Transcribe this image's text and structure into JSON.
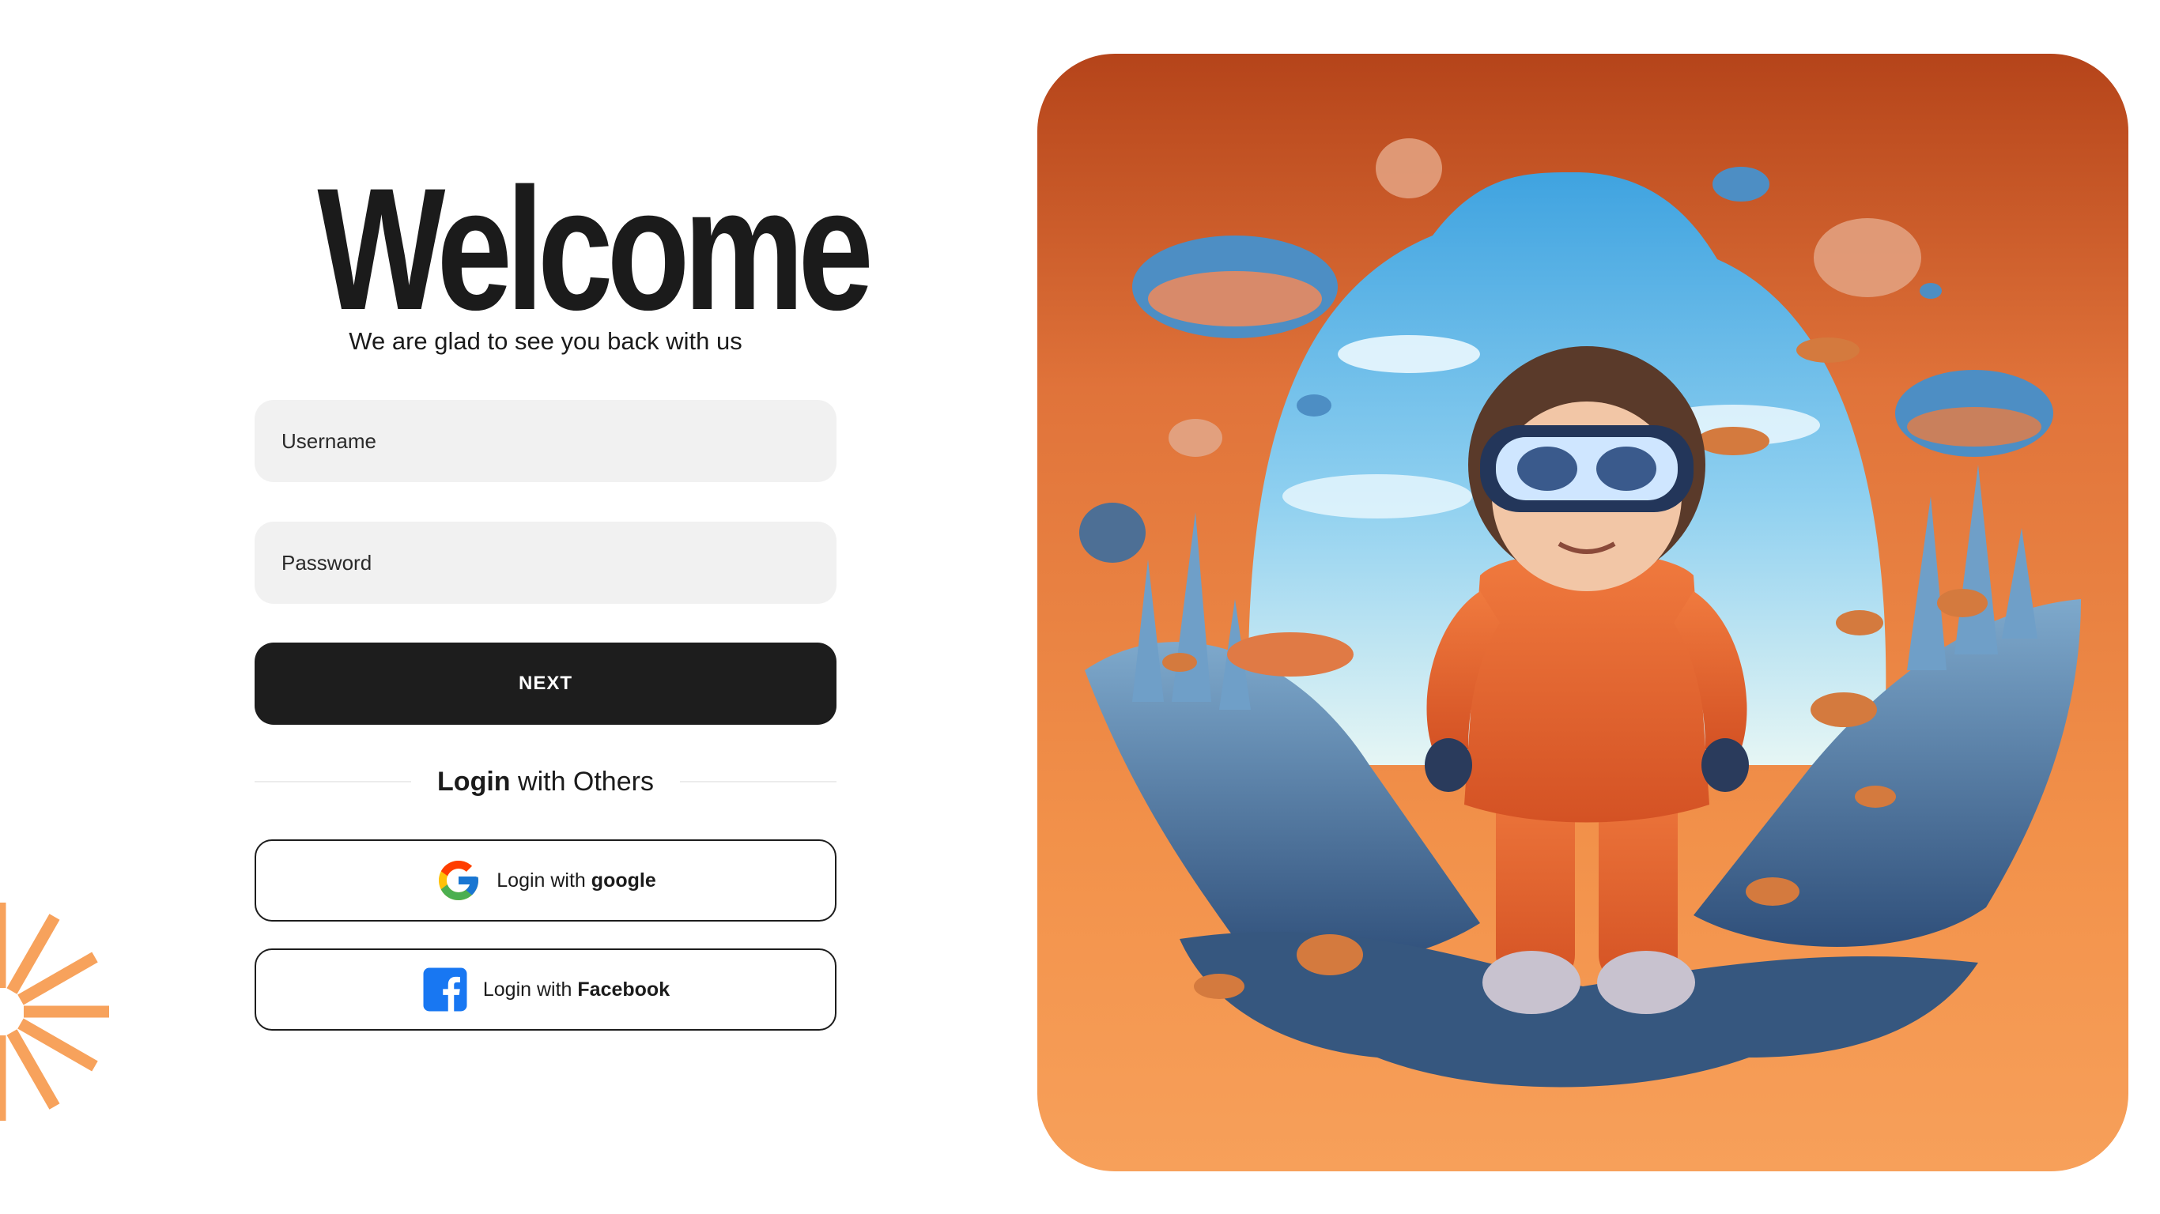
{
  "login": {
    "title": "Welcome",
    "subtitle": "We are glad to see you back with us",
    "username_placeholder": "Username",
    "password_placeholder": "Password",
    "next_label": "NEXT",
    "divider_bold": "Login",
    "divider_rest": " with Others",
    "google": {
      "prefix": "Login with ",
      "brand": "google",
      "icon": "google-icon"
    },
    "facebook": {
      "prefix": "Login with ",
      "brand": "Facebook",
      "icon": "facebook-icon"
    }
  },
  "colors": {
    "primary_button": "#1d1d1d",
    "input_bg": "#f1f1f1",
    "accent_orange": "#f7a25c",
    "hero_top": "#b5441a",
    "hero_bottom": "#f7a05a"
  },
  "illustration": {
    "icon": "vr-explorer-illustration"
  }
}
